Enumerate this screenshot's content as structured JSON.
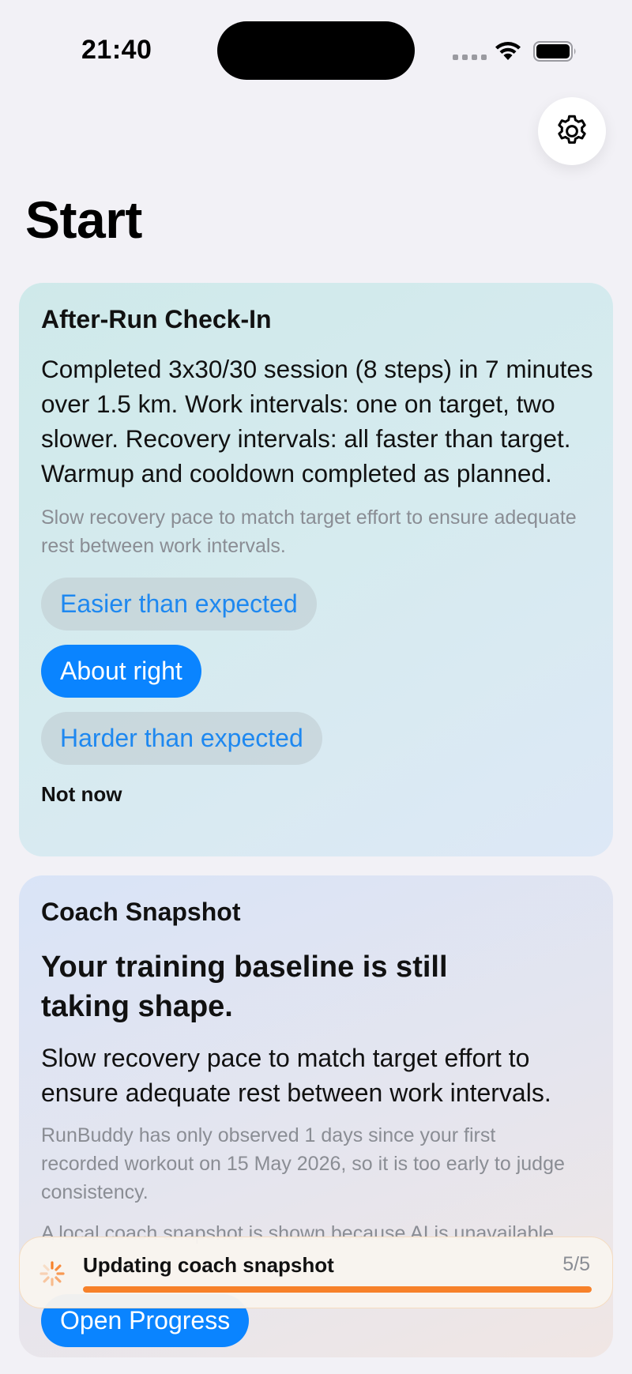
{
  "status_bar": {
    "time": "21:40"
  },
  "page": {
    "title": "Start"
  },
  "checkin": {
    "heading": "After-Run Check-In",
    "summary": "Completed 3x30/30 session (8 steps) in 7 minutes over 1.5 km. Work intervals: one on target, two slower. Recovery intervals: all faster than target. Warmup and cooldown completed as planned.",
    "hint": "Slow recovery pace to match target effort to ensure adequate rest between work intervals.",
    "options": [
      "Easier than expected",
      "About right",
      "Harder than expected"
    ],
    "selected": "About right",
    "dismiss": "Not now"
  },
  "snapshot": {
    "heading": "Coach Snapshot",
    "headline": "Your training baseline is still taking shape.",
    "body": "Slow recovery pace to match target effort to ensure adequate rest between work intervals.",
    "note": "RunBuddy has only observed 1 days since your first recorded workout on 15 May 2026, so it is too early to judge consistency.",
    "note2": "A local coach snapshot is shown because AI is unavailable",
    "action": "Open Progress"
  },
  "update_toast": {
    "label": "Updating coach snapshot",
    "count": "5/5",
    "progress": 1.0
  },
  "colors": {
    "accent": "#0a84ff",
    "progress": "#f7812a",
    "background": "#f2f1f6"
  },
  "icons": {
    "settings": "gear-icon",
    "loading": "spinner-icon",
    "wifi": "wifi-icon",
    "battery": "battery-icon"
  }
}
